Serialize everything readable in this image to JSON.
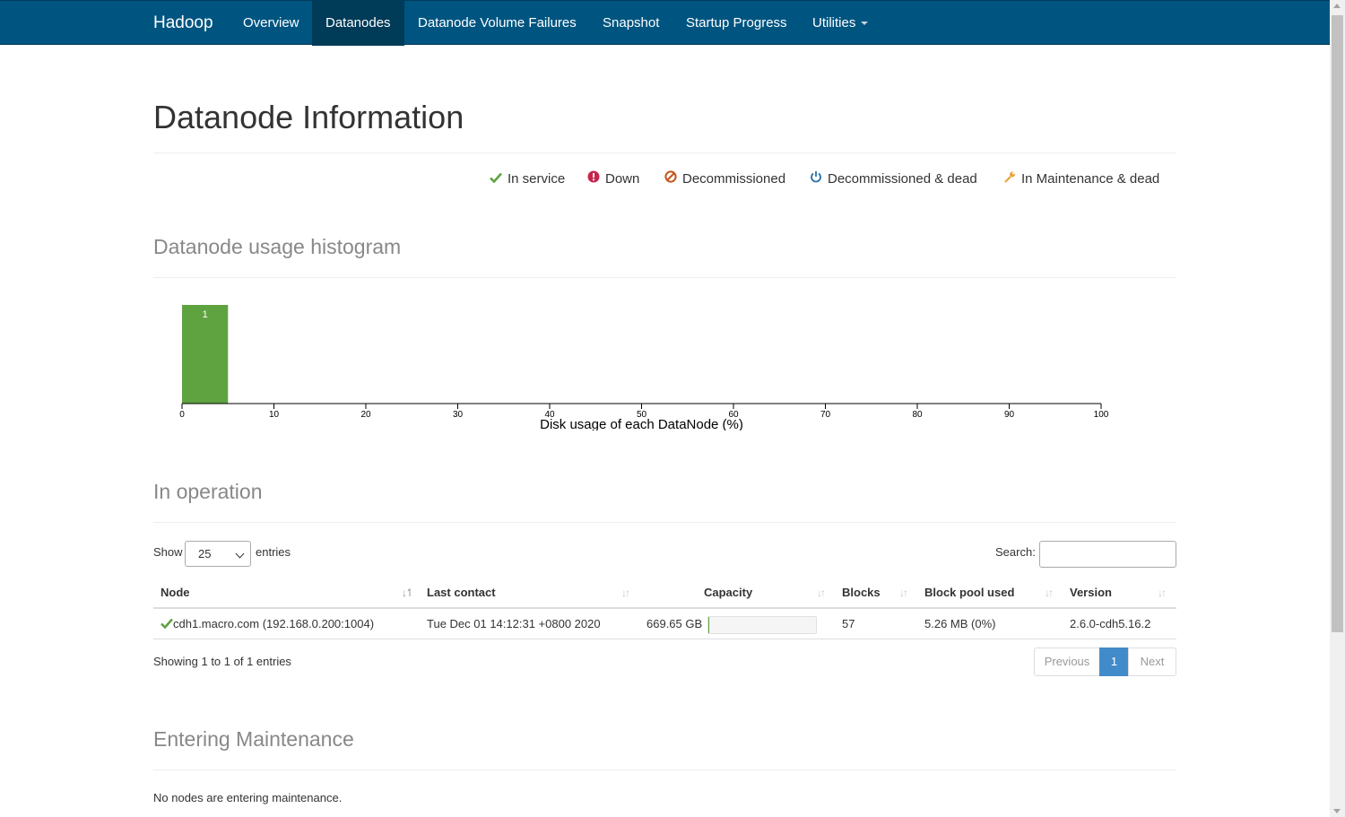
{
  "navbar": {
    "brand": "Hadoop",
    "items": [
      {
        "label": "Overview"
      },
      {
        "label": "Datanodes"
      },
      {
        "label": "Datanode Volume Failures"
      },
      {
        "label": "Snapshot"
      },
      {
        "label": "Startup Progress"
      },
      {
        "label": "Utilities"
      }
    ],
    "active": "Datanodes",
    "bg_color": "#005580"
  },
  "page": {
    "title": "Datanode Information"
  },
  "legend": [
    {
      "icon": "check-icon",
      "label": "In service",
      "color": "#5fa341"
    },
    {
      "icon": "exclamation-circle-icon",
      "label": "Down",
      "color": "#c7254e"
    },
    {
      "icon": "ban-icon",
      "label": "Decommissioned",
      "color": "#c3541a"
    },
    {
      "icon": "power-icon",
      "label": "Decommissioned & dead",
      "color": "#2a6ea6"
    },
    {
      "icon": "wrench-icon",
      "label": "In Maintenance & dead",
      "color": "#e8a33d"
    }
  ],
  "histogram": {
    "title": "Datanode usage histogram"
  },
  "chart_data": {
    "type": "bar",
    "xlabel": "Disk usage of each DataNode (%)",
    "ylabel": "",
    "xlim": [
      0,
      100
    ],
    "xticks": [
      0,
      10,
      20,
      30,
      40,
      50,
      60,
      70,
      80,
      90,
      100
    ],
    "bins": [
      {
        "x0": 0,
        "x1": 5,
        "count": 1
      }
    ],
    "bar_color": "#5fa341",
    "grid": false
  },
  "in_operation": {
    "title": "In operation",
    "show_label": "Show",
    "page_size": "25",
    "entries_label": "entries",
    "search_label": "Search:",
    "search_value": "",
    "columns": [
      "Node",
      "Last contact",
      "Capacity",
      "Blocks",
      "Block pool used",
      "Version"
    ],
    "rows": [
      {
        "status_icon": "check-icon",
        "node": "cdh1.macro.com (192.168.0.200:1004)",
        "last_contact": "Tue Dec 01 14:12:31 +0800 2020",
        "capacity": "669.65 GB",
        "capacity_used_fraction": 0.01,
        "blocks": "57",
        "block_pool_used": "5.26 MB (0%)",
        "version": "2.6.0-cdh5.16.2"
      }
    ],
    "info": "Showing 1 to 1 of 1 entries",
    "pagination": {
      "previous": "Previous",
      "current": "1",
      "next": "Next"
    }
  },
  "entering_maintenance": {
    "title": "Entering Maintenance",
    "empty_text": "No nodes are entering maintenance."
  }
}
